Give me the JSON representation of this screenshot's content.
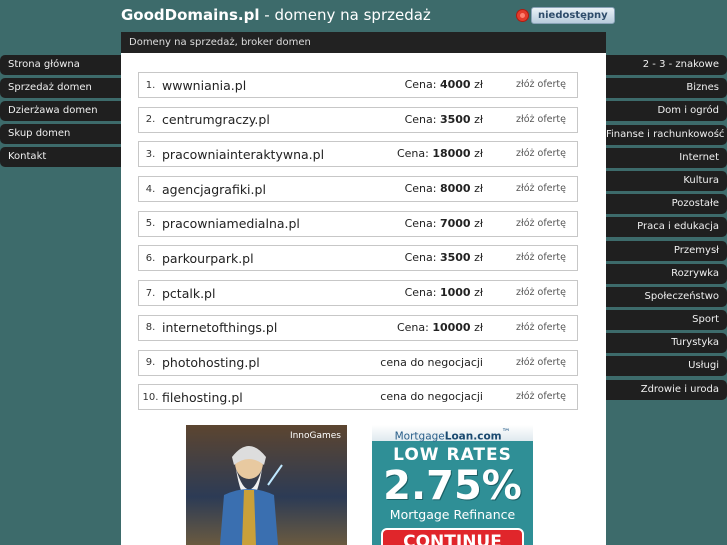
{
  "header": {
    "site_name": "GoodDomains.pl",
    "tagline": " - domeny na sprzedaż",
    "status_label": "niedostępny"
  },
  "subheader": "Domeny na sprzedaż, broker domen",
  "left_nav": [
    {
      "label": "Strona główna"
    },
    {
      "label": "Sprzedaż domen"
    },
    {
      "label": "Dzierżawa domen"
    },
    {
      "label": "Skup domen"
    },
    {
      "label": "Kontakt"
    }
  ],
  "right_nav": [
    {
      "label": "2 - 3 - znakowe"
    },
    {
      "label": "Biznes"
    },
    {
      "label": "Dom i ogród"
    },
    {
      "label": "Finanse i rachunkowość"
    },
    {
      "label": "Internet"
    },
    {
      "label": "Kultura"
    },
    {
      "label": "Pozostałe"
    },
    {
      "label": "Praca i edukacja"
    },
    {
      "label": "Przemysł"
    },
    {
      "label": "Rozrywka"
    },
    {
      "label": "Społeczeństwo"
    },
    {
      "label": "Sport"
    },
    {
      "label": "Turystyka"
    },
    {
      "label": "Usługi"
    },
    {
      "label": "Zdrowie i uroda"
    }
  ],
  "domains": [
    {
      "num": "1.",
      "name": "wwwniania.pl",
      "price_label": "Cena:",
      "price": "4000",
      "currency": "zł",
      "offer": "złóż ofertę"
    },
    {
      "num": "2.",
      "name": "centrumgraczy.pl",
      "price_label": "Cena:",
      "price": "3500",
      "currency": "zł",
      "offer": "złóż ofertę"
    },
    {
      "num": "3.",
      "name": "pracowniainteraktywna.pl",
      "price_label": "Cena:",
      "price": "18000",
      "currency": "zł",
      "offer": "złóż ofertę"
    },
    {
      "num": "4.",
      "name": "agencjagrafiki.pl",
      "price_label": "Cena:",
      "price": "8000",
      "currency": "zł",
      "offer": "złóż ofertę"
    },
    {
      "num": "5.",
      "name": "pracowniamedialna.pl",
      "price_label": "Cena:",
      "price": "7000",
      "currency": "zł",
      "offer": "złóż ofertę"
    },
    {
      "num": "6.",
      "name": "parkourpark.pl",
      "price_label": "Cena:",
      "price": "3500",
      "currency": "zł",
      "offer": "złóż ofertę"
    },
    {
      "num": "7.",
      "name": "pctalk.pl",
      "price_label": "Cena:",
      "price": "1000",
      "currency": "zł",
      "offer": "złóż ofertę"
    },
    {
      "num": "8.",
      "name": "internetofthings.pl",
      "price_label": "Cena:",
      "price": "10000",
      "currency": "zł",
      "offer": "złóż ofertę"
    },
    {
      "num": "9.",
      "name": "photohosting.pl",
      "price_label": "cena do negocjacji",
      "price": "",
      "currency": "",
      "offer": "złóż ofertę"
    },
    {
      "num": "10.",
      "name": "filehosting.pl",
      "price_label": "cena do negocjacji",
      "price": "",
      "currency": "",
      "offer": "złóż ofertę"
    }
  ],
  "ads": {
    "ad1_brand": "InnoGames",
    "ad2_brand_a": "Mortgage",
    "ad2_brand_b": "Loan.com",
    "ad2_tm": "™",
    "ad2_headline": "LOW RATES",
    "ad2_rate": "2.75%",
    "ad2_sub": "Mortgage Refinance",
    "ad2_button": "CONTINUE"
  }
}
